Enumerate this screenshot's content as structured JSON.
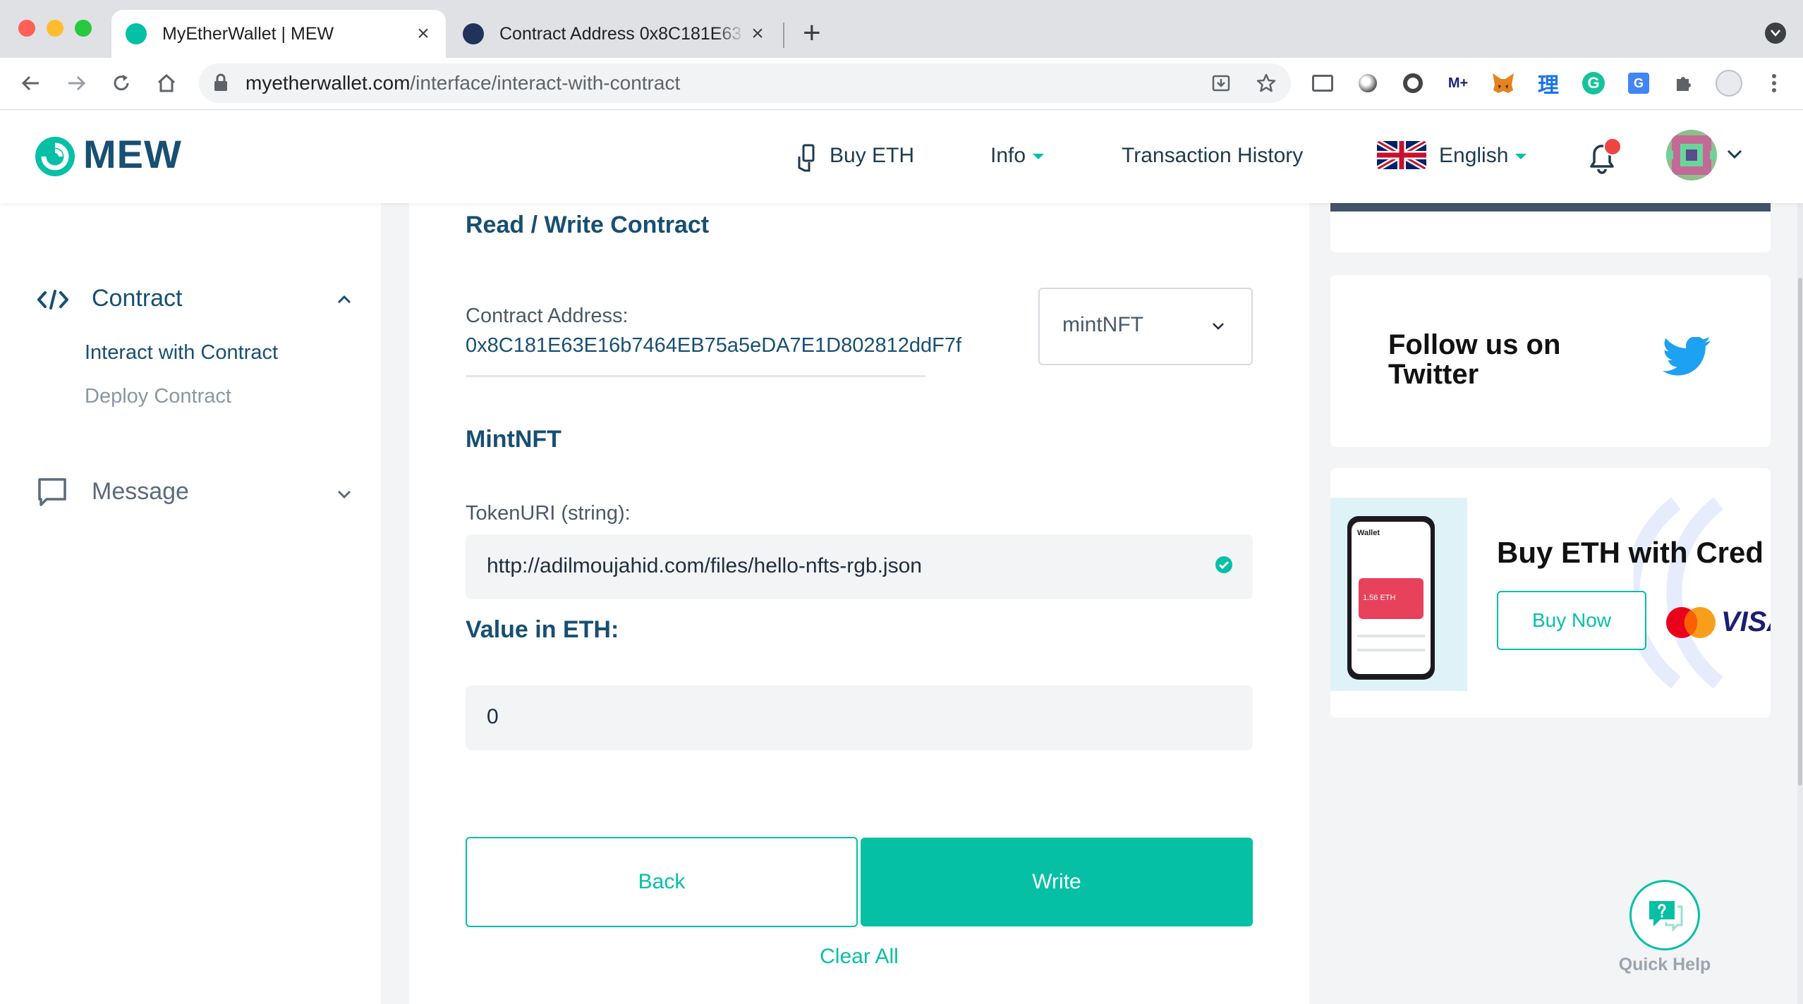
{
  "browser": {
    "tabs": [
      {
        "title": "MyEtherWallet | MEW",
        "active": true
      },
      {
        "title": "Contract Address 0x8C181E63",
        "active": false
      }
    ],
    "new_tab_symbol": "+",
    "url_domain": "myetherwallet.com",
    "url_path": "/interface/interact-with-contract"
  },
  "header": {
    "logo_text": "MEW",
    "nav": {
      "buy_eth": "Buy ETH",
      "info": "Info",
      "transaction_history": "Transaction History",
      "language": "English"
    }
  },
  "sidebar": {
    "contract": {
      "label": "Contract",
      "items": [
        "Interact with Contract",
        "Deploy Contract"
      ]
    },
    "message": {
      "label": "Message"
    }
  },
  "main": {
    "title": "Read / Write Contract",
    "contract_address_label": "Contract Address:",
    "contract_address": "0x8C181E63E16b7464EB75a5eDA7E1D802812ddF7f",
    "function_select": "mintNFT",
    "function_title": "MintNFT",
    "token_uri_label": "TokenURI (string):",
    "token_uri_value": "http://adilmoujahid.com/files/hello-nfts-rgb.json",
    "value_label": "Value in ETH:",
    "value": "0",
    "back_button": "Back",
    "write_button": "Write",
    "clear_all": "Clear All"
  },
  "right": {
    "twitter_title": "Follow us on Twitter",
    "buy_title": "Buy ETH with Cred",
    "buy_button": "Buy Now",
    "card_brands": [
      "MasterCard",
      "VISA"
    ],
    "phone_wallet_label": "Wallet",
    "phone_balance": "1.56 ETH"
  },
  "quick_help": "Quick Help",
  "colors": {
    "accent": "#05c0a5",
    "navy": "#184f73",
    "twitter": "#1da1f2",
    "notification": "#ef4444"
  }
}
